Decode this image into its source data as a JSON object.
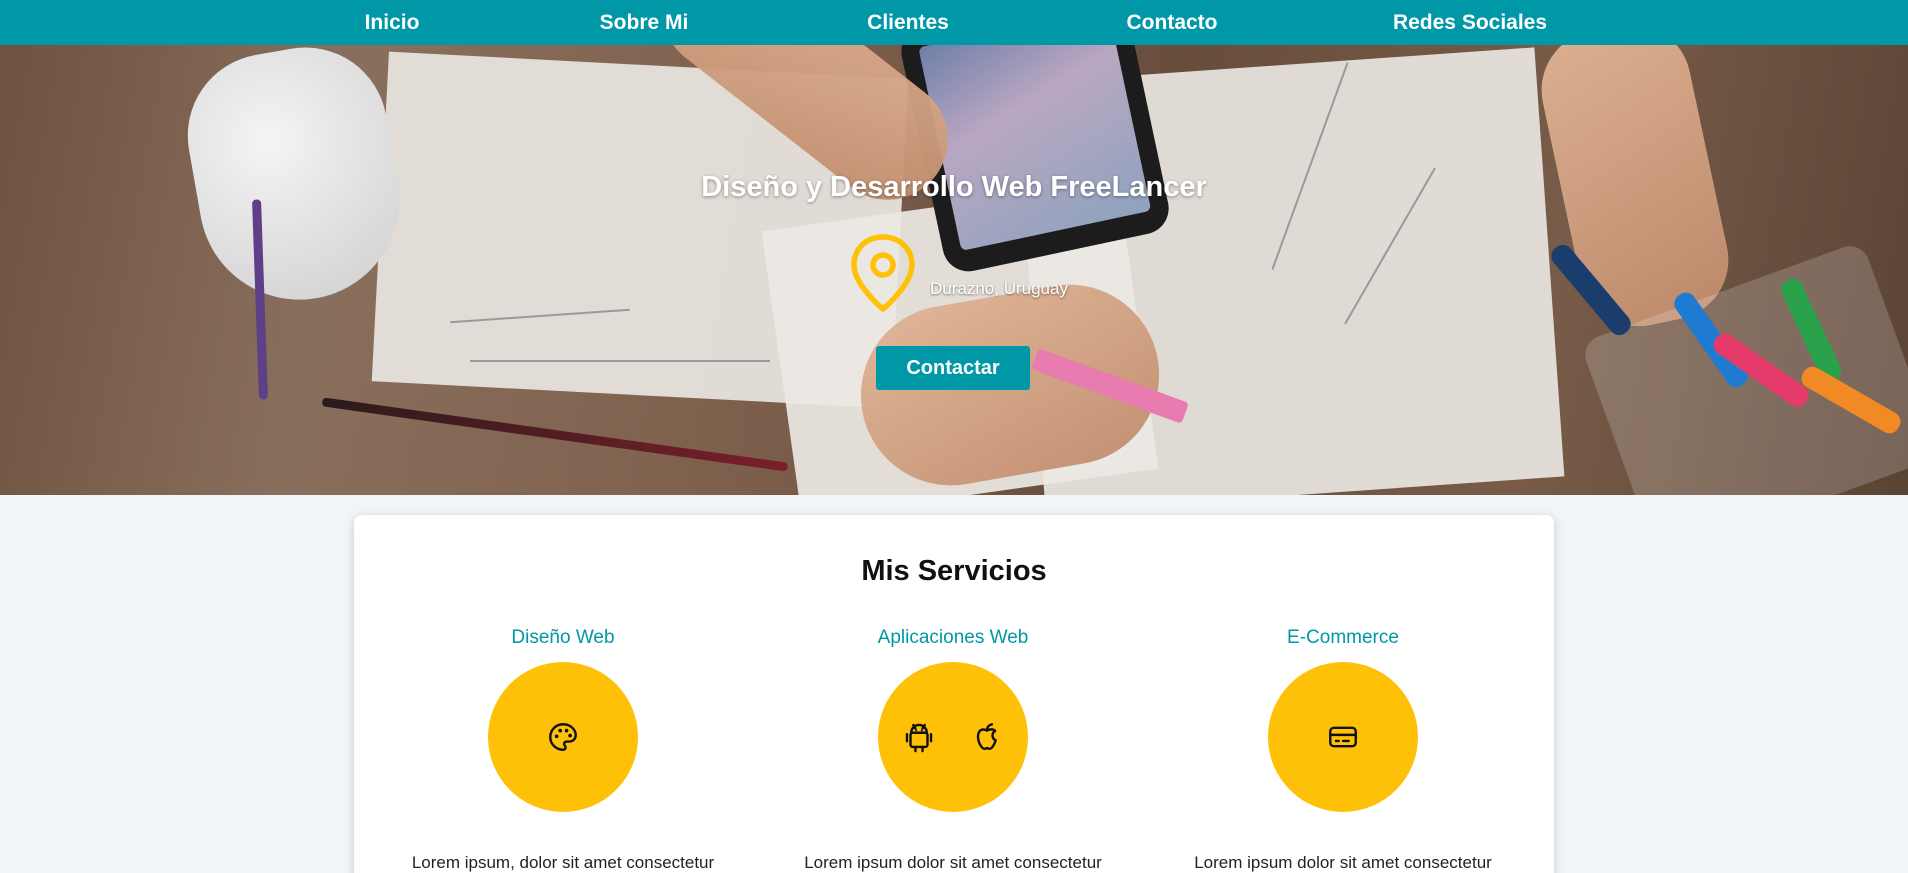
{
  "nav": {
    "items": [
      {
        "label": "Inicio"
      },
      {
        "label": "Sobre Mi"
      },
      {
        "label": "Clientes"
      },
      {
        "label": "Contacto"
      },
      {
        "label": "Redes Sociales"
      }
    ]
  },
  "hero": {
    "title": "Diseño y Desarrollo Web FreeLancer",
    "location": "Durazno, Uruguay",
    "location_icon": "map-pin-icon",
    "button_label": "Contactar"
  },
  "services": {
    "title": "Mis Servicios",
    "items": [
      {
        "name": "Diseño Web",
        "icons": [
          "palette-icon"
        ],
        "description": "Lorem ipsum, dolor sit amet consectetur"
      },
      {
        "name": "Aplicaciones Web",
        "icons": [
          "android-icon",
          "apple-icon"
        ],
        "description": "Lorem ipsum dolor sit amet consectetur"
      },
      {
        "name": "E-Commerce",
        "icons": [
          "credit-card-icon"
        ],
        "description": "Lorem ipsum dolor sit amet consectetur"
      }
    ]
  },
  "colors": {
    "primary": "#0097a7",
    "accent": "#ffc107",
    "background": "#f1f5f9",
    "card": "#ffffff"
  }
}
